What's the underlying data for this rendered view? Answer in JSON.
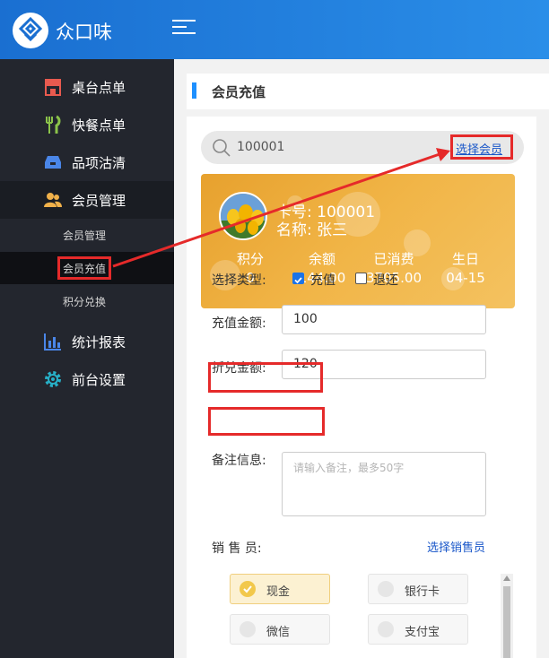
{
  "app": {
    "title": "众口味"
  },
  "colors": {
    "header": "#1a6fd1",
    "sidebar": "#23262e",
    "accent": "#1e90ff",
    "card": "#f1b547",
    "annotation": "#e52a2a"
  },
  "sidebar": {
    "items": [
      {
        "label": "桌台点单",
        "icon": "store-icon"
      },
      {
        "label": "快餐点单",
        "icon": "fork-knife-icon"
      },
      {
        "label": "品项沽清",
        "icon": "inbox-icon"
      },
      {
        "label": "会员管理",
        "icon": "users-icon"
      },
      {
        "label": "统计报表",
        "icon": "bar-chart-icon"
      },
      {
        "label": "前台设置",
        "icon": "gear-icon"
      }
    ],
    "sub_items": [
      {
        "label": "会员管理"
      },
      {
        "label": "会员充值"
      },
      {
        "label": "积分兑换"
      }
    ]
  },
  "page": {
    "title": "会员充值"
  },
  "search": {
    "value": "100001",
    "select_member": "选择会员"
  },
  "card": {
    "card_no": "卡号: 100001",
    "name": "名称: 张三",
    "stats": [
      {
        "label": "积分",
        "value": "0"
      },
      {
        "label": "余额",
        "value": "144.00"
      },
      {
        "label": "已消费",
        "value": "3705.00"
      },
      {
        "label": "生日",
        "value": "04-15"
      }
    ]
  },
  "form": {
    "type_label": "选择类型:",
    "type_options": [
      {
        "label": "充值",
        "checked": true
      },
      {
        "label": "退还",
        "checked": false
      }
    ],
    "recharge_label": "充值金额:",
    "recharge_value": "100",
    "discount_label": "折兑金额:",
    "discount_value": "120",
    "remark_label": "备注信息:",
    "remark_placeholder": "请输入备注，最多50字",
    "seller_label": "销 售 员:",
    "seller_link": "选择销售员"
  },
  "payments": [
    {
      "label": "现金",
      "selected": true
    },
    {
      "label": "银行卡",
      "selected": false
    },
    {
      "label": "微信",
      "selected": false
    },
    {
      "label": "支付宝",
      "selected": false
    }
  ]
}
